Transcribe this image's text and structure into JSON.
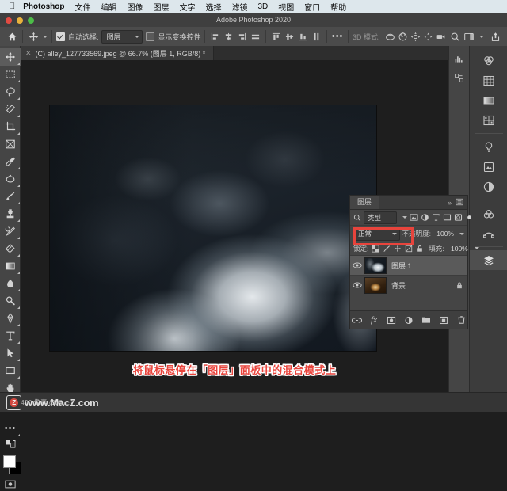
{
  "menubar": {
    "apple_icon": "apple-icon",
    "app_name": "Photoshop",
    "items": [
      "文件",
      "编辑",
      "图像",
      "图层",
      "文字",
      "选择",
      "滤镜",
      "3D",
      "视图",
      "窗口",
      "帮助"
    ]
  },
  "titlebar": {
    "title": "Adobe Photoshop 2020"
  },
  "options_bar": {
    "home_icon": "home-icon",
    "tool_icon": "move-tool-icon",
    "auto_select_label": "自动选择:",
    "auto_select_checked": true,
    "auto_select_value": "图层",
    "show_transform_label": "显示变换控件",
    "show_transform_checked": false,
    "align_left": "align-left-icon",
    "align_center_h": "align-center-horizontal-icon",
    "align_right": "align-right-icon",
    "distribute_h": "distribute-horizontal-icon",
    "align_top": "align-top-icon",
    "align_center_v": "align-center-vertical-icon",
    "align_bottom": "align-bottom-icon",
    "distribute_v": "distribute-vertical-icon",
    "more_label": "•••",
    "mode3d_label": "3D 模式:",
    "search_icon": "search-icon",
    "workspace_icon": "workspace-icon",
    "share_icon": "share-icon"
  },
  "document_tab": {
    "close_icon": "close-icon",
    "title": "(C) alley_127733569.jpeg @ 66.7% (图层 1, RGB/8) *"
  },
  "toolbar": {
    "tools": [
      {
        "name": "move-tool",
        "selected": true,
        "flyout": true
      },
      {
        "name": "marquee-tool",
        "selected": false,
        "flyout": true
      },
      {
        "name": "lasso-tool",
        "selected": false,
        "flyout": true
      },
      {
        "name": "quick-selection-tool",
        "selected": false,
        "flyout": true
      },
      {
        "name": "crop-tool",
        "selected": false,
        "flyout": true
      },
      {
        "name": "frame-tool",
        "selected": false,
        "flyout": false
      },
      {
        "name": "eyedropper-tool",
        "selected": false,
        "flyout": true
      },
      {
        "name": "healing-brush-tool",
        "selected": false,
        "flyout": true
      },
      {
        "name": "brush-tool",
        "selected": false,
        "flyout": true
      },
      {
        "name": "clone-stamp-tool",
        "selected": false,
        "flyout": true
      },
      {
        "name": "history-brush-tool",
        "selected": false,
        "flyout": true
      },
      {
        "name": "eraser-tool",
        "selected": false,
        "flyout": true
      },
      {
        "name": "gradient-tool",
        "selected": false,
        "flyout": true
      },
      {
        "name": "blur-tool",
        "selected": false,
        "flyout": true
      },
      {
        "name": "dodge-tool",
        "selected": false,
        "flyout": true
      },
      {
        "name": "pen-tool",
        "selected": false,
        "flyout": true
      },
      {
        "name": "type-tool",
        "selected": false,
        "flyout": true
      },
      {
        "name": "path-selection-tool",
        "selected": false,
        "flyout": true
      },
      {
        "name": "rectangle-tool",
        "selected": false,
        "flyout": true
      },
      {
        "name": "hand-tool",
        "selected": false,
        "flyout": true
      },
      {
        "name": "zoom-tool",
        "selected": false,
        "flyout": false
      }
    ],
    "edit_toolbar_label": "•••",
    "foreground_color": "#ffffff",
    "background_color": "#000000",
    "quick_mask_icon": "quick-mask-icon"
  },
  "canvas": {
    "caption": "将鼠标悬停在「图层」面板中的混合模式上"
  },
  "layers_panel": {
    "tab_label": "图层",
    "collapse_icon": "chevron-double-right-icon",
    "menu_icon": "panel-menu-icon",
    "filter": {
      "search_icon": "search-icon",
      "kind_label": "类型",
      "icons": [
        "filter-pixel-icon",
        "filter-adjustment-icon",
        "filter-type-icon",
        "filter-shape-icon",
        "filter-smart-object-icon"
      ],
      "toggle_icon": "filter-toggle-icon"
    },
    "blend_mode": "正常",
    "opacity_label": "不透明度:",
    "opacity_value": "100%",
    "lock_label": "锁定:",
    "lock_icons": [
      "lock-transparent-pixels-icon",
      "lock-image-pixels-icon",
      "lock-position-icon",
      "lock-artboard-icon",
      "lock-all-icon"
    ],
    "fill_label": "填充:",
    "fill_value": "100%",
    "layers": [
      {
        "name": "图层 1",
        "visible": true,
        "selected": true,
        "locked": false,
        "thumb": "smoke-thumbnail"
      },
      {
        "name": "背景",
        "visible": true,
        "selected": false,
        "locked": true,
        "thumb": "background-thumbnail"
      }
    ],
    "footer_icons": [
      "link-layers-icon",
      "layer-style-fx-icon",
      "add-mask-icon",
      "adjustment-layer-icon",
      "new-group-icon",
      "new-layer-icon",
      "delete-layer-icon"
    ],
    "highlight_color": "#e8443c"
  },
  "right_dock": {
    "narrow_items": [
      "histogram-panel-icon",
      "info-panel-icon"
    ],
    "wide_items": [
      {
        "name": "color-panel-icon",
        "active": false
      },
      {
        "name": "swatches-panel-icon",
        "active": false
      },
      {
        "name": "gradients-panel-icon",
        "active": false
      },
      {
        "name": "patterns-panel-icon",
        "active": false
      },
      {
        "name": "adjustments-panel-icon",
        "active": false
      },
      {
        "name": "libraries-panel-icon",
        "active": false
      },
      {
        "name": "adjustment-circle-icon",
        "active": false
      },
      {
        "name": "styles-panel-icon",
        "active": false
      },
      {
        "name": "paths-panel-icon",
        "active": false
      },
      {
        "name": "layers-panel-icon",
        "active": true
      }
    ]
  },
  "status_bar": {
    "text": "400 像素 (300… )",
    "watermark": "www.MacZ.com",
    "watermark_badge": "Z"
  }
}
